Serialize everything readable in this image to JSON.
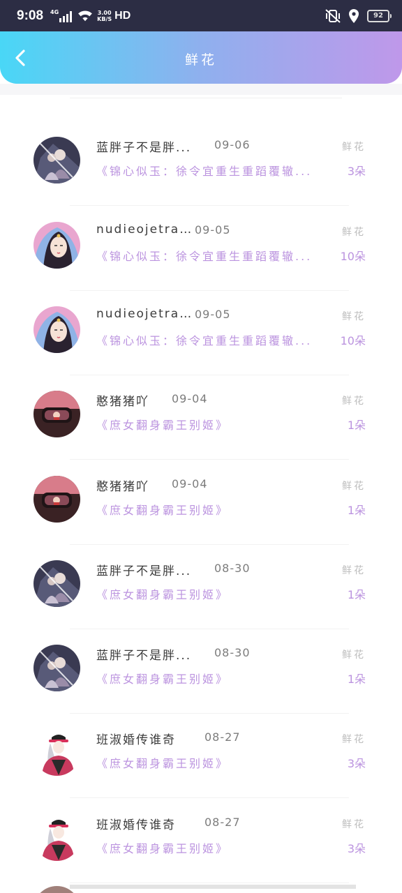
{
  "status_bar": {
    "time": "9:08",
    "network": "4G",
    "speed_value": "3.00",
    "speed_unit": "KB/S",
    "hd": "HD",
    "battery": "92"
  },
  "header": {
    "title": "鲜花",
    "back_icon": "chevron-left-icon"
  },
  "rows": [
    {
      "name": "蓝胖子不是胖...",
      "date": "09-06",
      "type": "鲜花",
      "book": "《锦心似玉：徐令宜重生重蹈覆辙...",
      "count": "3朵",
      "avatar": "avatar-couple"
    },
    {
      "name": "nudieojetrans",
      "date": "09-05",
      "type": "鲜花",
      "book": "《锦心似玉：徐令宜重生重蹈覆辙...",
      "count": "10朵",
      "avatar": "avatar-veiled-woman"
    },
    {
      "name": "nudieojetrans",
      "date": "09-05",
      "type": "鲜花",
      "book": "《锦心似玉：徐令宜重生重蹈覆辙...",
      "count": "10朵",
      "avatar": "avatar-veiled-woman"
    },
    {
      "name": "憨猪猪吖",
      "date": "09-04",
      "type": "鲜花",
      "book": "《庶女翻身霸王别姬》",
      "count": "1朵",
      "avatar": "avatar-car-mirror"
    },
    {
      "name": "憨猪猪吖",
      "date": "09-04",
      "type": "鲜花",
      "book": "《庶女翻身霸王别姬》",
      "count": "1朵",
      "avatar": "avatar-car-mirror"
    },
    {
      "name": "蓝胖子不是胖...",
      "date": "08-30",
      "type": "鲜花",
      "book": "《庶女翻身霸王别姬》",
      "count": "1朵",
      "avatar": "avatar-couple"
    },
    {
      "name": "蓝胖子不是胖...",
      "date": "08-30",
      "type": "鲜花",
      "book": "《庶女翻身霸王别姬》",
      "count": "1朵",
      "avatar": "avatar-couple"
    },
    {
      "name": "班淑婚传谁奇",
      "date": "08-27",
      "type": "鲜花",
      "book": "《庶女翻身霸王别姬》",
      "count": "3朵",
      "avatar": "avatar-cartoon-girl"
    },
    {
      "name": "班淑婚传谁奇",
      "date": "08-27",
      "type": "鲜花",
      "book": "《庶女翻身霸王别姬》",
      "count": "3朵",
      "avatar": "avatar-cartoon-girl"
    }
  ]
}
